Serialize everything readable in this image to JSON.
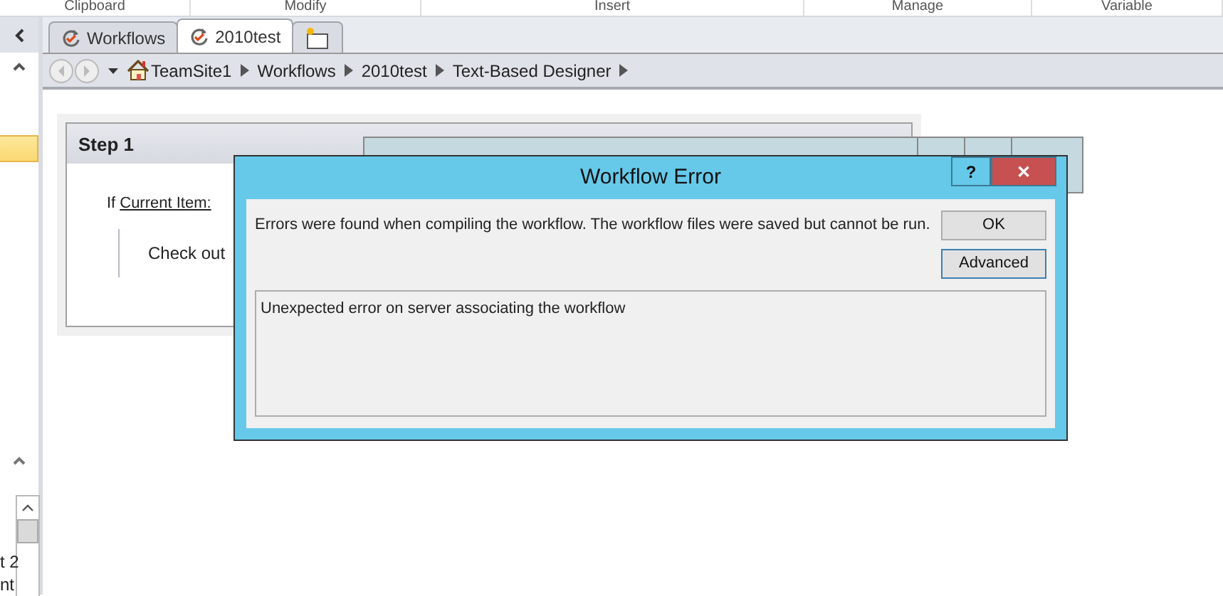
{
  "ribbon_groups": [
    {
      "label": "Clipboard"
    },
    {
      "label": "Modify"
    },
    {
      "label": "Insert"
    },
    {
      "label": "Manage"
    },
    {
      "label": "Variable"
    }
  ],
  "sidebar": {
    "fragments": [
      "t 2",
      "nt"
    ]
  },
  "tabs": [
    {
      "label": "Workflows",
      "selected": false
    },
    {
      "label": "2010test",
      "selected": true
    }
  ],
  "breadcrumb": [
    "TeamSite1",
    "Workflows",
    "2010test",
    "Text-Based Designer"
  ],
  "step": {
    "title": "Step 1",
    "keyword": "If",
    "link": "Current Item:",
    "action": "Check out"
  },
  "dialog": {
    "title": "Workflow Error",
    "message": "Errors were found when compiling the workflow. The workflow files were saved but cannot be run.",
    "buttons": [
      {
        "label": "OK",
        "focused": false
      },
      {
        "label": "Advanced",
        "focused": true
      }
    ],
    "controls": [
      {
        "label": "?"
      },
      {
        "label": "✕"
      }
    ],
    "details": "Unexpected error on server associating the workflow"
  }
}
